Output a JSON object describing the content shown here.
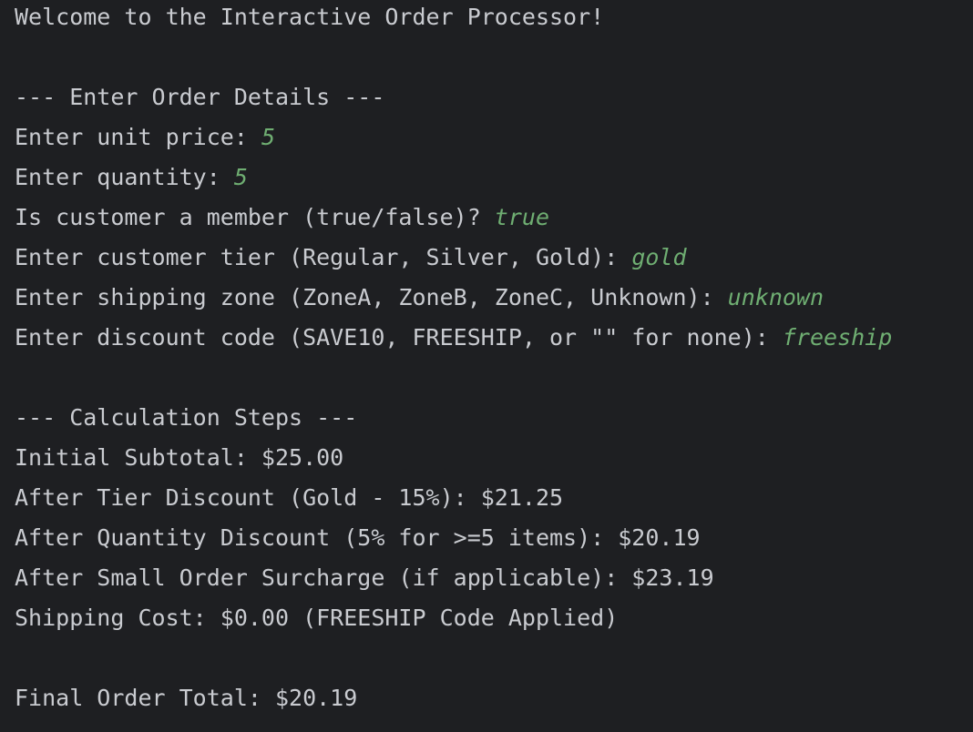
{
  "console": {
    "welcome": "Welcome to the Interactive Order Processor!",
    "order_header": "--- Enter Order Details ---",
    "prompts": [
      {
        "label": "Enter unit price: ",
        "value": "5"
      },
      {
        "label": "Enter quantity: ",
        "value": "5"
      },
      {
        "label": "Is customer a member (true/false)? ",
        "value": "true"
      },
      {
        "label": "Enter customer tier (Regular, Silver, Gold): ",
        "value": "gold"
      },
      {
        "label": "Enter shipping zone (ZoneA, ZoneB, ZoneC, Unknown): ",
        "value": "unknown"
      },
      {
        "label": "Enter discount code (SAVE10, FREESHIP, or \"\" for none): ",
        "value": "freeship"
      }
    ],
    "calc_header": "--- Calculation Steps ---",
    "steps": [
      "Initial Subtotal: $25.00",
      "After Tier Discount (Gold - 15%): $21.25",
      "After Quantity Discount (5% for >=5 items): $20.19",
      "After Small Order Surcharge (if applicable): $23.19",
      "Shipping Cost: $0.00 (FREESHIP Code Applied)"
    ],
    "final_total": "Final Order Total: $20.19"
  },
  "colors": {
    "background": "#1e1f22",
    "text": "#c9cbd0",
    "user_input": "#6fae72"
  }
}
